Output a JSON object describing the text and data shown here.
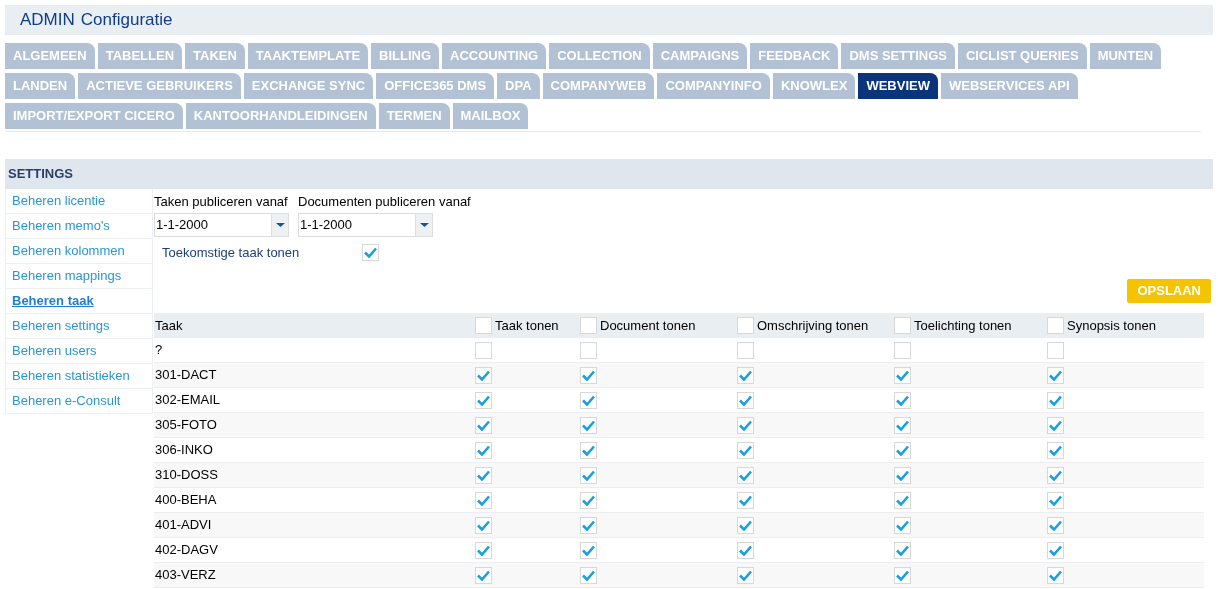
{
  "header": {
    "title_bold": "ADMIN",
    "title": "Configuratie"
  },
  "tab_rows": [
    [
      {
        "label": "ALGEMEEN",
        "selected": false
      },
      {
        "label": "TABELLEN",
        "selected": false
      },
      {
        "label": "TAKEN",
        "selected": false
      },
      {
        "label": "TAAKTEMPLATE",
        "selected": false
      },
      {
        "label": "BILLING",
        "selected": false
      },
      {
        "label": "ACCOUNTING",
        "selected": false
      },
      {
        "label": "COLLECTION",
        "selected": false
      },
      {
        "label": "CAMPAIGNS",
        "selected": false
      },
      {
        "label": "FEEDBACK",
        "selected": false
      },
      {
        "label": "DMS SETTINGS",
        "selected": false
      },
      {
        "label": "CICLIST QUERIES",
        "selected": false
      },
      {
        "label": "MUNTEN",
        "selected": false
      }
    ],
    [
      {
        "label": "LANDEN",
        "selected": false
      },
      {
        "label": "ACTIEVE GEBRUIKERS",
        "selected": false
      },
      {
        "label": "EXCHANGE SYNC",
        "selected": false
      },
      {
        "label": "OFFICE365 DMS",
        "selected": false
      },
      {
        "label": "DPA",
        "selected": false
      },
      {
        "label": "COMPANYWEB",
        "selected": false
      },
      {
        "label": "COMPANYINFO",
        "selected": false
      },
      {
        "label": "KNOWLEX",
        "selected": false
      },
      {
        "label": "WEBVIEW",
        "selected": true
      },
      {
        "label": "WEBSERVICES API",
        "selected": false
      }
    ],
    [
      {
        "label": "IMPORT/EXPORT CICERO",
        "selected": false
      },
      {
        "label": "KANTOORHANDLEIDINGEN",
        "selected": false
      },
      {
        "label": "TERMEN",
        "selected": false
      },
      {
        "label": "MAILBOX",
        "selected": false
      }
    ]
  ],
  "settings": {
    "title": "SETTINGS"
  },
  "sidebar": {
    "items": [
      {
        "label": "Beheren licentie",
        "selected": false
      },
      {
        "label": "Beheren memo's",
        "selected": false
      },
      {
        "label": "Beheren kolommen",
        "selected": false
      },
      {
        "label": "Beheren mappings",
        "selected": false
      },
      {
        "label": "Beheren taak",
        "selected": true
      },
      {
        "label": "Beheren settings",
        "selected": false
      },
      {
        "label": "Beheren users",
        "selected": false
      },
      {
        "label": "Beheren statistieken",
        "selected": false
      },
      {
        "label": "Beheren e-Consult",
        "selected": false
      }
    ]
  },
  "dates": [
    {
      "label": "Taken publiceren vanaf",
      "value": "1-1-2000"
    },
    {
      "label": "Documenten publiceren vanaf",
      "value": "1-1-2000"
    }
  ],
  "future_tasks": {
    "label": "Toekomstige taak tonen",
    "checked": true
  },
  "save_button": "OPSLAAN",
  "table": {
    "first_column": "Taak",
    "columns": [
      {
        "label": "Taak tonen",
        "checked": false
      },
      {
        "label": "Document tonen",
        "checked": false
      },
      {
        "label": "Omschrijving tonen",
        "checked": false
      },
      {
        "label": "Toelichting tonen",
        "checked": false
      },
      {
        "label": "Synopsis tonen",
        "checked": false
      }
    ],
    "rows": [
      {
        "taak": "?",
        "checks": [
          false,
          false,
          false,
          false,
          false
        ]
      },
      {
        "taak": "301-DACT",
        "checks": [
          true,
          true,
          true,
          true,
          true
        ]
      },
      {
        "taak": "302-EMAIL",
        "checks": [
          true,
          true,
          true,
          true,
          true
        ]
      },
      {
        "taak": "305-FOTO",
        "checks": [
          true,
          true,
          true,
          true,
          true
        ]
      },
      {
        "taak": "306-INKO",
        "checks": [
          true,
          true,
          true,
          true,
          true
        ]
      },
      {
        "taak": "310-DOSS",
        "checks": [
          true,
          true,
          true,
          true,
          true
        ]
      },
      {
        "taak": "400-BEHA",
        "checks": [
          true,
          true,
          true,
          true,
          true
        ]
      },
      {
        "taak": "401-ADVI",
        "checks": [
          true,
          true,
          true,
          true,
          true
        ]
      },
      {
        "taak": "402-DAGV",
        "checks": [
          true,
          true,
          true,
          true,
          true
        ]
      },
      {
        "taak": "403-VERZ",
        "checks": [
          true,
          true,
          true,
          true,
          true
        ]
      }
    ]
  }
}
